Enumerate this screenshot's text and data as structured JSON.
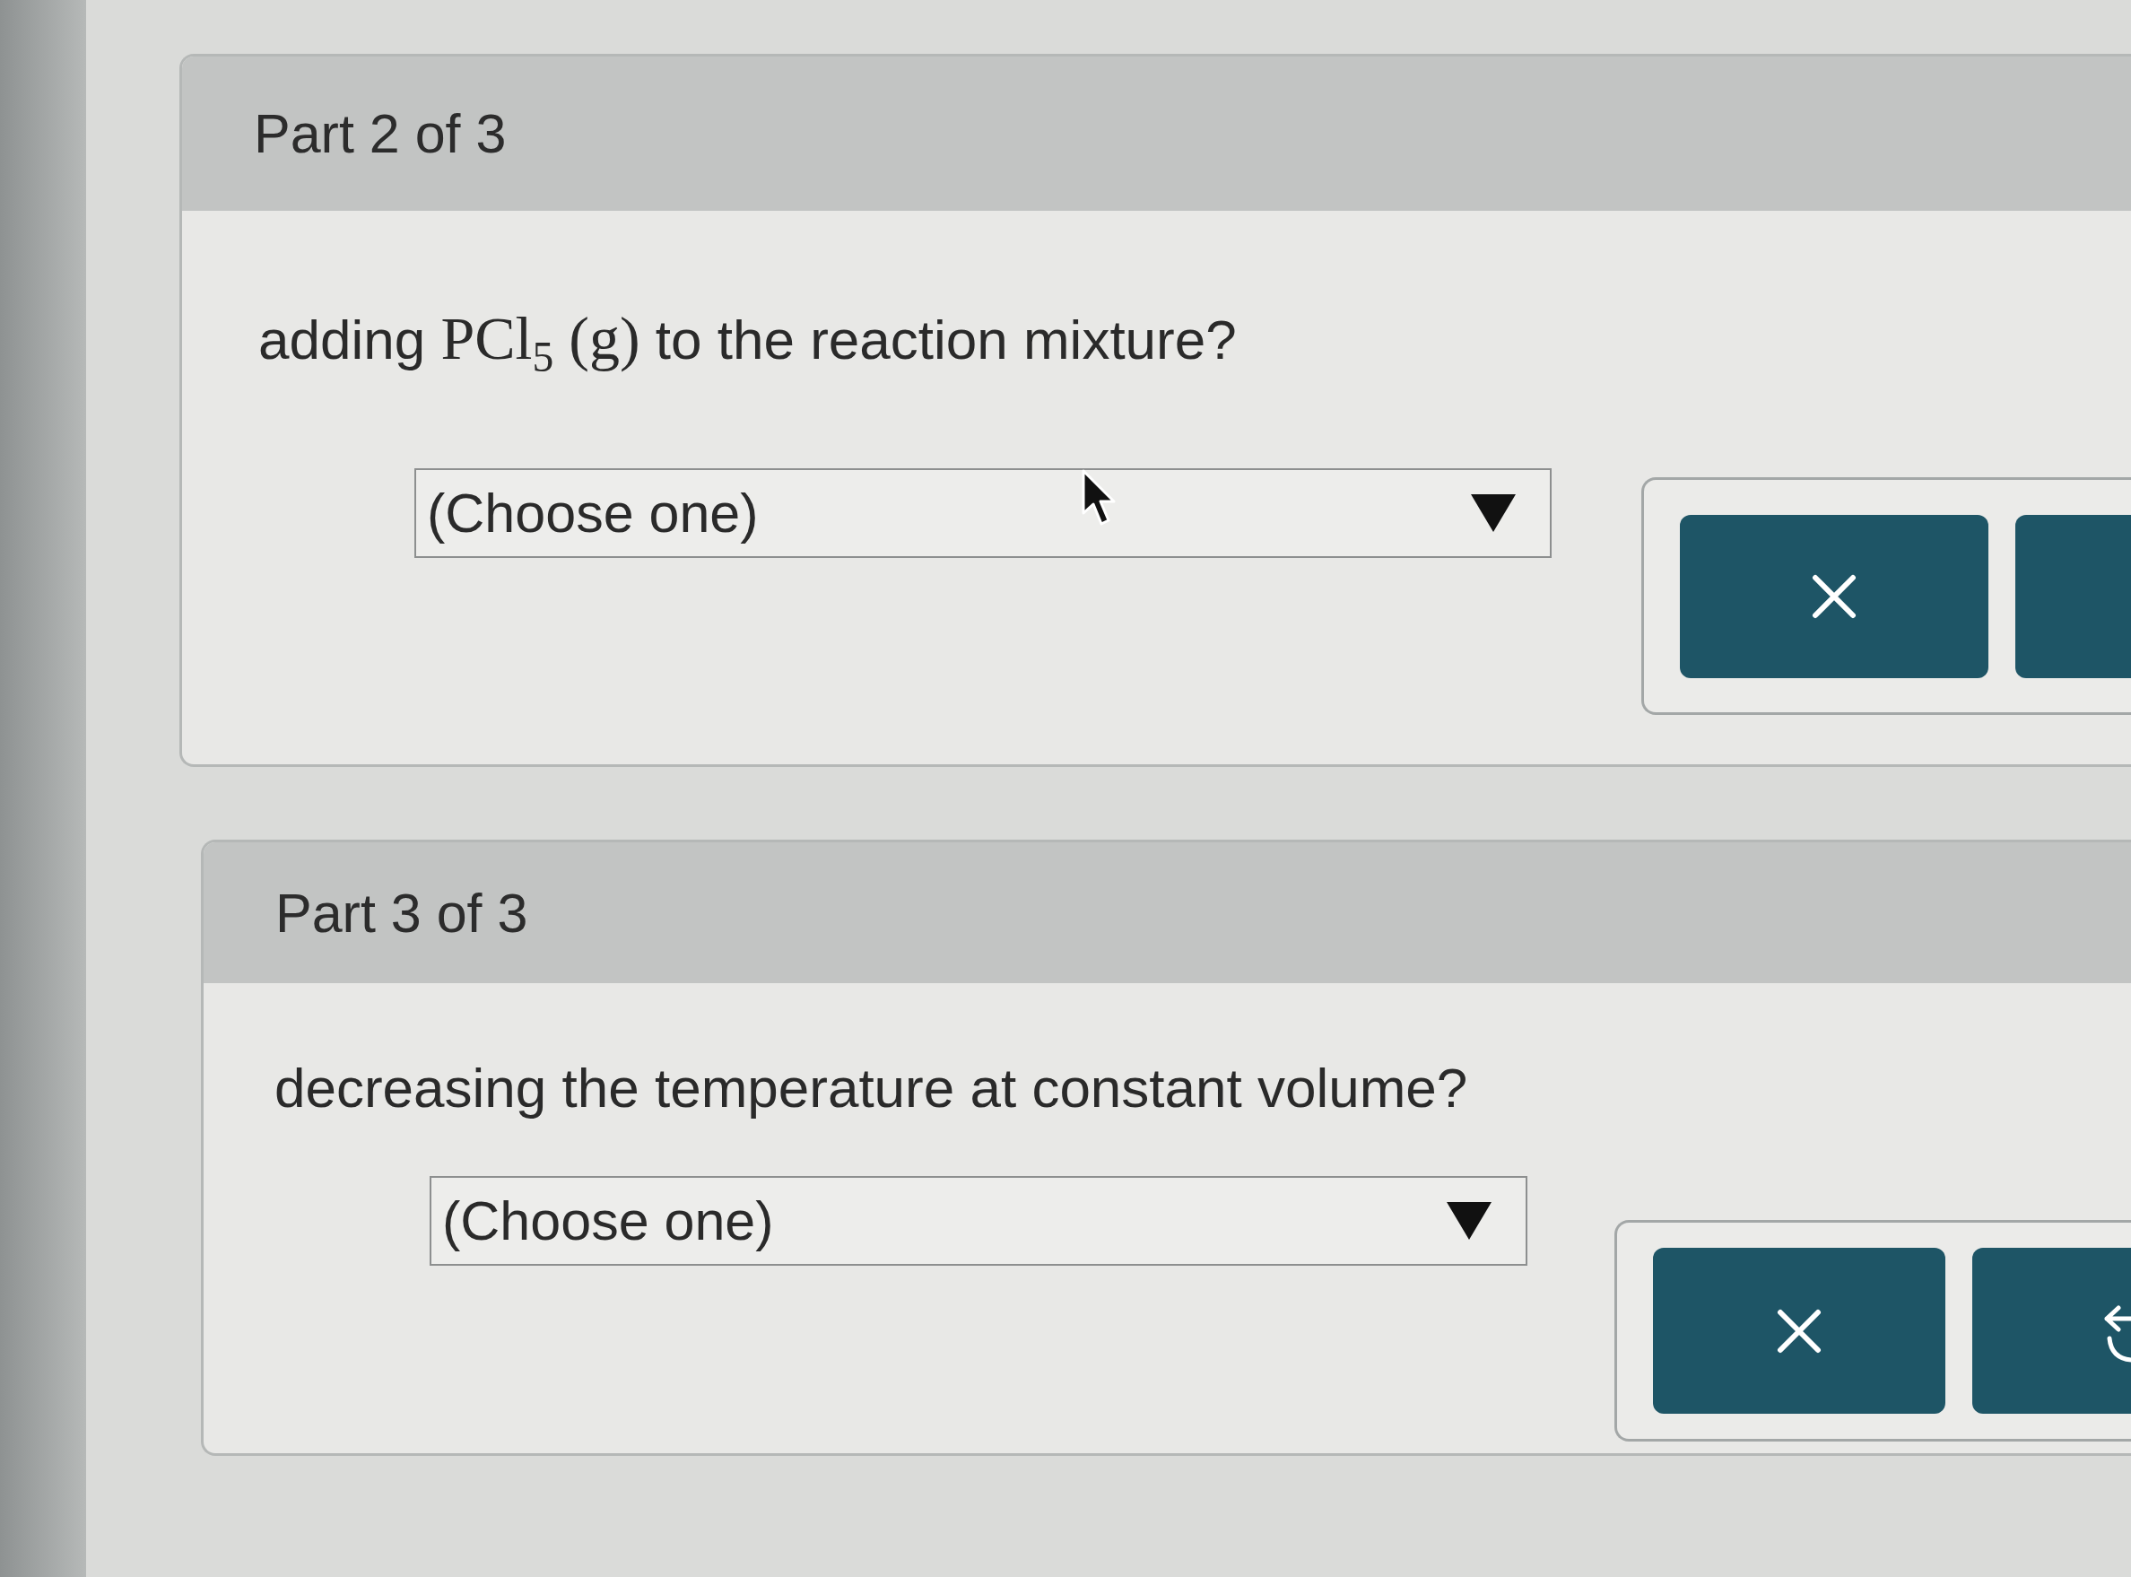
{
  "parts": [
    {
      "header": "Part 2 of 3",
      "question": [
        {
          "kind": "text",
          "text": "adding "
        },
        {
          "kind": "math",
          "text": "PCl$_{5}$ (g)"
        },
        {
          "kind": "text",
          "text": " to the reaction mixture?"
        }
      ],
      "dropdown": {
        "value": "(Choose one)"
      },
      "buttons": [
        {
          "kind": "clear"
        },
        {
          "kind": "plain"
        }
      ]
    },
    {
      "header": "Part 3 of 3",
      "question": [
        {
          "kind": "text",
          "text": "decreasing the temperature at constant volume?"
        }
      ],
      "dropdown": {
        "value": "(Choose one)"
      },
      "buttons": [
        {
          "kind": "clear"
        },
        {
          "kind": "undo"
        }
      ]
    }
  ]
}
